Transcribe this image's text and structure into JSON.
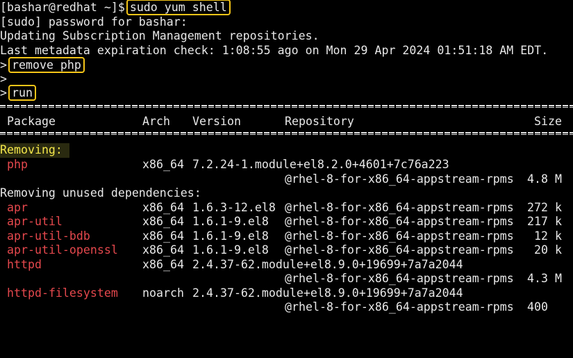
{
  "terminal": {
    "prompt": "[bashar@redhat ~]$",
    "command": "sudo yum shell",
    "line_sudo": "[sudo] password for bashar:",
    "line_updating": "Updating Subscription Management repositories.",
    "line_metadata": "Last metadata expiration check: 1:08:55 ago on Mon 29 Apr 2024 01:51:18 AM EDT.",
    "shell_prompt": ">",
    "cmd_remove": "remove php",
    "cmd_run": "run",
    "colors": {
      "highlight": "#f5c518",
      "package": "#e5484d",
      "removing": "#f3e64a",
      "text": "#e8e8e8"
    }
  },
  "table": {
    "headers": {
      "package": "Package",
      "arch": "Arch",
      "version": "Version",
      "repository": "Repository",
      "size": "Size"
    },
    "removing_label": "Removing:",
    "unused_label": "Removing unused dependencies:",
    "removing": [
      {
        "package": "php",
        "arch": "x86_64",
        "version": "7.2.24-1.module+el8.2.0+4601+7c76a223",
        "repository": "@rhel-8-for-x86_64-appstream-rpms",
        "size": "4.8 M"
      }
    ],
    "unused": [
      {
        "package": "apr",
        "arch": "x86_64",
        "version": "1.6.3-12.el8",
        "repository": "@rhel-8-for-x86_64-appstream-rpms",
        "size": "272 k"
      },
      {
        "package": "apr-util",
        "arch": "x86_64",
        "version": "1.6.1-9.el8",
        "repository": "@rhel-8-for-x86_64-appstream-rpms",
        "size": "217 k"
      },
      {
        "package": "apr-util-bdb",
        "arch": "x86_64",
        "version": "1.6.1-9.el8",
        "repository": "@rhel-8-for-x86_64-appstream-rpms",
        "size": "12 k"
      },
      {
        "package": "apr-util-openssl",
        "arch": "x86_64",
        "version": "1.6.1-9.el8",
        "repository": "@rhel-8-for-x86_64-appstream-rpms",
        "size": "20 k"
      },
      {
        "package": "httpd",
        "arch": "x86_64",
        "version": "2.4.37-62.module+el8.9.0+19699+7a7a2044",
        "repository": "@rhel-8-for-x86_64-appstream-rpms",
        "size": "4.3 M"
      },
      {
        "package": "httpd-filesystem",
        "arch": "noarch",
        "version": "2.4.37-62.module+el8.9.0+19699+7a7a2044",
        "repository": "@rhel-8-for-x86_64-appstream-rpms",
        "size": "400"
      }
    ]
  }
}
